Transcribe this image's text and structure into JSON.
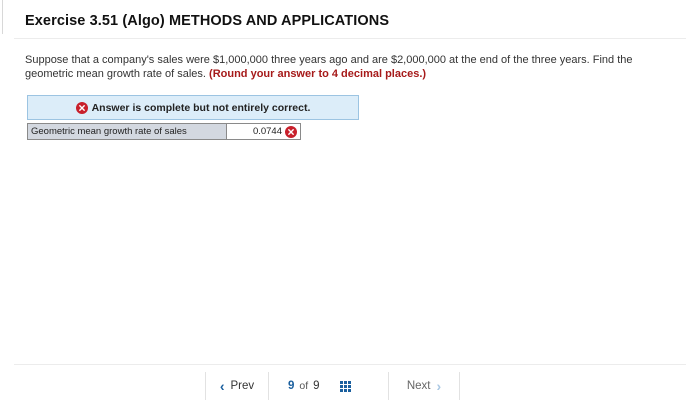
{
  "exercise": {
    "title": "Exercise 3.51 (Algo) METHODS AND APPLICATIONS"
  },
  "question": {
    "text": "Suppose that a company's sales were $1,000,000 three years ago and are $2,000,000 at the end of the three years. Find the geometric mean growth rate of sales.",
    "instruction": "(Round your answer to 4 decimal places.)"
  },
  "feedback": {
    "status_text": "Answer is complete but not entirely correct.",
    "status_icon": "x-circle-icon",
    "error_color": "#c8202c"
  },
  "answer": {
    "label": "Geometric mean growth rate of sales",
    "value": "0.0744",
    "result_icon": "x-circle-icon"
  },
  "navigation": {
    "prev_label": "Prev",
    "next_label": "Next",
    "current_page": "9",
    "of_label": "of",
    "total_pages": "9",
    "grid_icon": "grid-icon",
    "accent_color": "#1a5f9e"
  }
}
